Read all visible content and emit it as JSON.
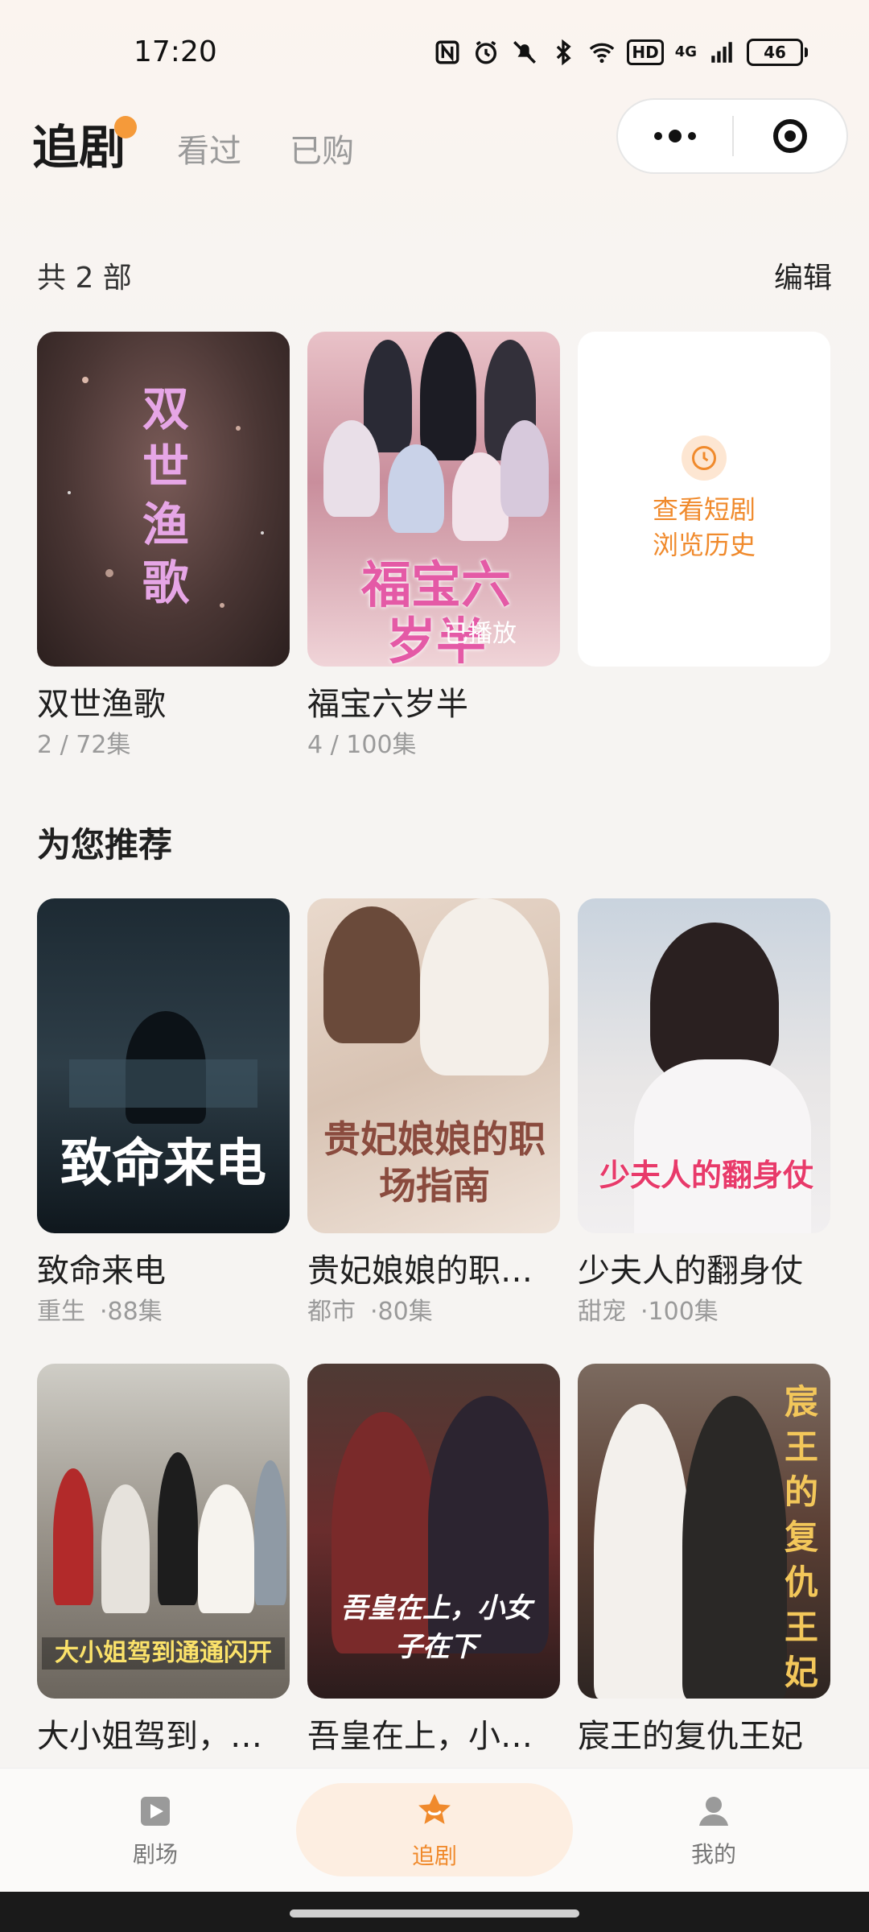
{
  "status_bar": {
    "time": "17:20",
    "network": "4G",
    "hd": "HD",
    "battery": "46"
  },
  "header": {
    "tabs": [
      {
        "label": "追剧",
        "active": true
      },
      {
        "label": "看过",
        "active": false
      },
      {
        "label": "已购",
        "active": false
      }
    ],
    "accent_color": "#f59a3a"
  },
  "tracked": {
    "count_label": "共 2 部",
    "edit_label": "编辑",
    "items": [
      {
        "title": "双世渔歌",
        "progress": "2 / 72集",
        "poster_text": "双世渔歌"
      },
      {
        "title": "福宝六岁半",
        "progress": "4 / 100集",
        "poster_text": "福宝六岁半",
        "badge": "已播放"
      }
    ],
    "history": {
      "line1": "查看短剧",
      "line2": "浏览历史"
    }
  },
  "recommend": {
    "section_title": "为您推荐",
    "items": [
      {
        "title": "致命来电",
        "tag": "重生",
        "episodes": "·88集",
        "poster_text": "致命来电"
      },
      {
        "title": "贵妃娘娘的职…",
        "tag": "都市",
        "episodes": "·80集",
        "poster_text": "贵妃娘娘的职场指南"
      },
      {
        "title": "少夫人的翻身仗",
        "tag": "甜宠",
        "episodes": "·100集",
        "poster_text": "少夫人的翻身仗"
      },
      {
        "title": "大小姐驾到，…",
        "poster_text": "大小姐驾到通通闪开"
      },
      {
        "title": "吾皇在上，小…",
        "poster_text": "吾皇在上，小女子在下"
      },
      {
        "title": "宸王的复仇王妃",
        "poster_text": "宸王的复仇王妃"
      }
    ]
  },
  "bottom_nav": [
    {
      "label": "剧场",
      "icon": "play-icon",
      "active": false
    },
    {
      "label": "追剧",
      "icon": "star-icon",
      "active": true
    },
    {
      "label": "我的",
      "icon": "person-icon",
      "active": false
    }
  ]
}
